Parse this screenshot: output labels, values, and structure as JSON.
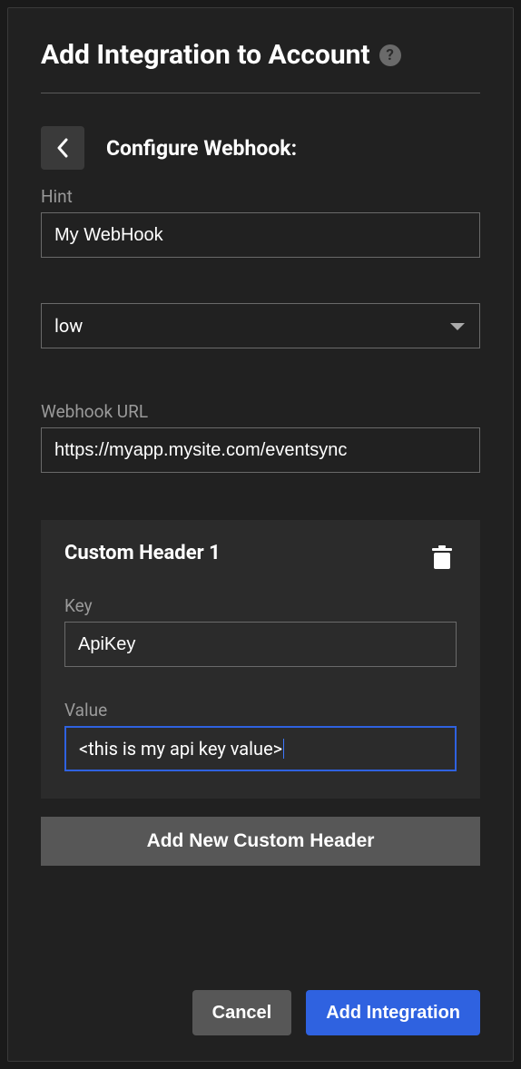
{
  "header": {
    "title": "Add Integration to Account"
  },
  "section": {
    "title": "Configure Webhook:"
  },
  "fields": {
    "hint": {
      "label": "Hint",
      "value": "My WebHook"
    },
    "priority": {
      "value": "low"
    },
    "webhook_url": {
      "label": "Webhook URL",
      "value": "https://myapp.mysite.com/eventsync"
    }
  },
  "custom_header": {
    "title": "Custom Header 1",
    "key": {
      "label": "Key",
      "value": "ApiKey"
    },
    "value": {
      "label": "Value",
      "value": "<this is my api key value>"
    }
  },
  "buttons": {
    "add_header": "Add New Custom Header",
    "cancel": "Cancel",
    "submit": "Add Integration"
  }
}
